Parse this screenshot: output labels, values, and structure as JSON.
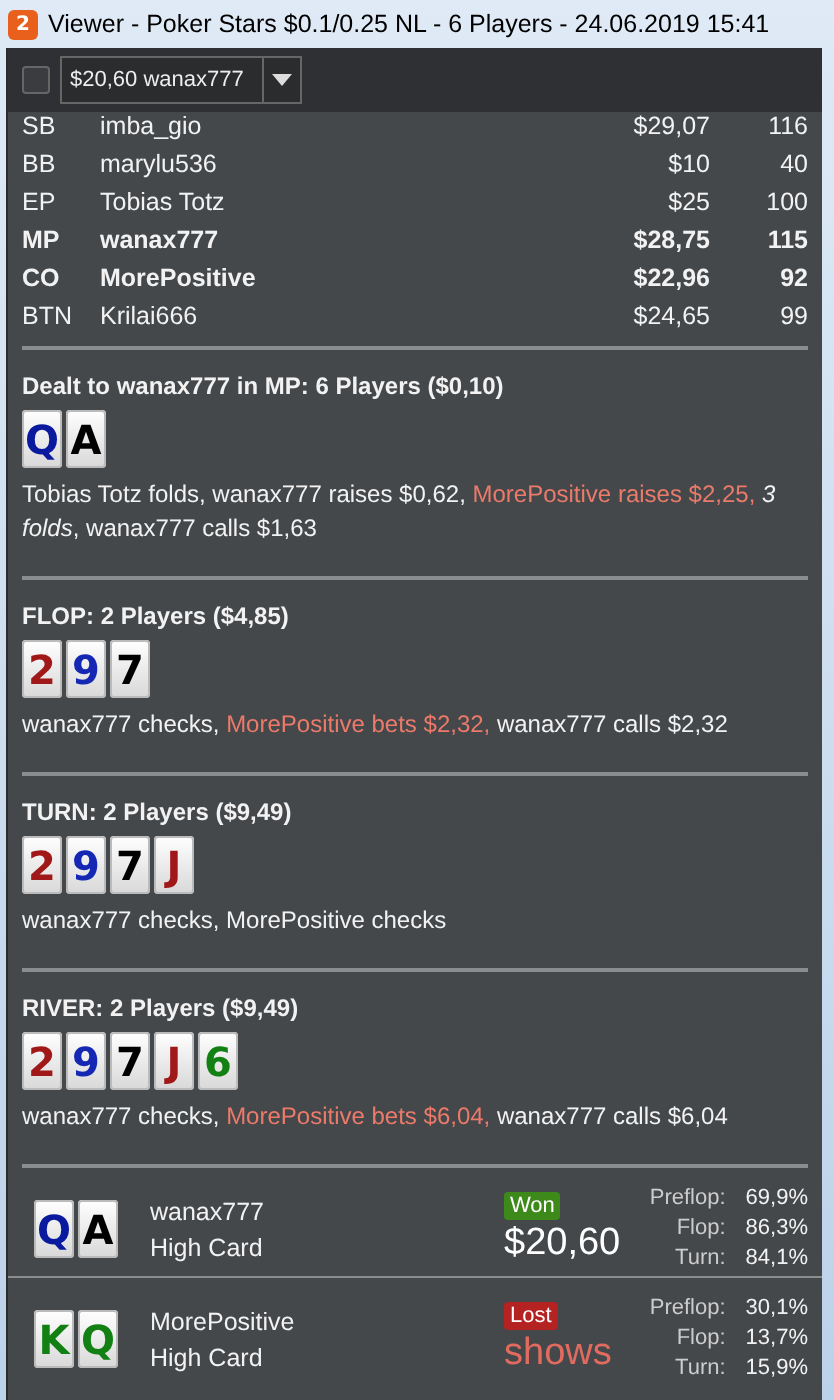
{
  "window": {
    "title": "Viewer - Poker Stars $0.1/0.25 NL - 6 Players - 24.06.2019 15:41",
    "badge": "2"
  },
  "toolbar": {
    "checkbox": {
      "checked": false
    },
    "dropdown": {
      "value": "$20,60 wanax777"
    }
  },
  "players": [
    {
      "position": "SB",
      "name": "imba_gio",
      "stack": "$29,07",
      "bb": "116",
      "highlighted": false
    },
    {
      "position": "BB",
      "name": "marylu536",
      "stack": "$10",
      "bb": "40",
      "highlighted": false
    },
    {
      "position": "EP",
      "name": "Tobias Totz",
      "stack": "$25",
      "bb": "100",
      "highlighted": false
    },
    {
      "position": "MP",
      "name": "wanax777",
      "stack": "$28,75",
      "bb": "115",
      "highlighted": true
    },
    {
      "position": "CO",
      "name": "MorePositive",
      "stack": "$22,96",
      "bb": "92",
      "highlighted": true
    },
    {
      "position": "BTN",
      "name": "Krilai666",
      "stack": "$24,65",
      "bb": "99",
      "highlighted": false
    }
  ],
  "streets": [
    {
      "heading": "Dealt to wanax777 in MP: 6 Players ($0,10)",
      "cards": [
        {
          "rank": "Q",
          "color": "#0a1a9e"
        },
        {
          "rank": "A",
          "color": "#000000"
        }
      ],
      "actions": [
        {
          "text": "Tobias Totz folds, wanax777 raises $0,62, ",
          "kind": "normal"
        },
        {
          "text": "MorePositive raises $2,25, ",
          "kind": "aggressor"
        },
        {
          "text": "3 folds",
          "kind": "summary"
        },
        {
          "text": ", wanax777 calls $1,63",
          "kind": "normal"
        }
      ]
    },
    {
      "heading": "FLOP: 2 Players ($4,85)",
      "cards": [
        {
          "rank": "2",
          "color": "#a01818"
        },
        {
          "rank": "9",
          "color": "#1428b4"
        },
        {
          "rank": "7",
          "color": "#000000"
        }
      ],
      "actions": [
        {
          "text": "wanax777 checks, ",
          "kind": "normal"
        },
        {
          "text": "MorePositive bets $2,32, ",
          "kind": "aggressor"
        },
        {
          "text": "wanax777 calls $2,32",
          "kind": "normal"
        }
      ]
    },
    {
      "heading": "TURN: 2 Players ($9,49)",
      "cards": [
        {
          "rank": "2",
          "color": "#a01818"
        },
        {
          "rank": "9",
          "color": "#1428b4"
        },
        {
          "rank": "7",
          "color": "#000000"
        },
        {
          "rank": "J",
          "color": "#a01818"
        }
      ],
      "actions": [
        {
          "text": "wanax777 checks, MorePositive checks",
          "kind": "normal"
        }
      ]
    },
    {
      "heading": "RIVER: 2 Players ($9,49)",
      "cards": [
        {
          "rank": "2",
          "color": "#a01818"
        },
        {
          "rank": "9",
          "color": "#1428b4"
        },
        {
          "rank": "7",
          "color": "#000000"
        },
        {
          "rank": "J",
          "color": "#a01818"
        },
        {
          "rank": "6",
          "color": "#128012"
        }
      ],
      "actions": [
        {
          "text": "wanax777 checks, ",
          "kind": "normal"
        },
        {
          "text": "MorePositive bets $6,04, ",
          "kind": "aggressor"
        },
        {
          "text": "wanax777 calls $6,04",
          "kind": "normal"
        }
      ]
    }
  ],
  "results": [
    {
      "cards": [
        {
          "rank": "Q",
          "color": "#0a1a9e"
        },
        {
          "rank": "A",
          "color": "#000000"
        }
      ],
      "name": "wanax777",
      "hand": "High Card",
      "outcome": {
        "label": "Won",
        "kind": "won"
      },
      "amount": "$20,60",
      "equity": [
        {
          "street": "Preflop:",
          "value": "69,9%"
        },
        {
          "street": "Flop:",
          "value": "86,3%"
        },
        {
          "street": "Turn:",
          "value": "84,1%"
        }
      ]
    },
    {
      "cards": [
        {
          "rank": "K",
          "color": "#128012"
        },
        {
          "rank": "Q",
          "color": "#128012"
        }
      ],
      "name": "MorePositive",
      "hand": "High Card",
      "outcome": {
        "label": "Lost",
        "kind": "lost"
      },
      "amount": "shows",
      "equity": [
        {
          "street": "Preflop:",
          "value": "30,1%"
        },
        {
          "street": "Flop:",
          "value": "13,7%"
        },
        {
          "street": "Turn:",
          "value": "15,9%"
        }
      ]
    }
  ]
}
